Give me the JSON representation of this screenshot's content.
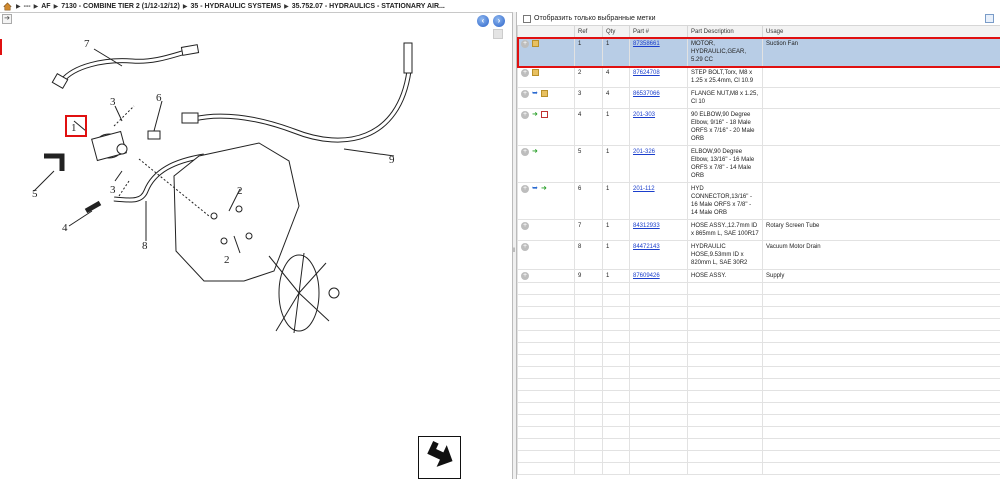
{
  "breadcrumb": {
    "items": [
      "---",
      "AF",
      "7130 - COMBINE TIER 2 (1/12-12/12)",
      "35 - HYDRAULIC SYSTEMS",
      "35.752.07 - HYDRAULICS - STATIONARY AIR..."
    ]
  },
  "diagram": {
    "callouts": [
      "1",
      "2",
      "2",
      "3",
      "3",
      "4",
      "5",
      "6",
      "7",
      "8",
      "9"
    ]
  },
  "filter": {
    "label": "Отобразить только выбранные метки",
    "checked": false
  },
  "table": {
    "headers": [
      "",
      "Ref",
      "Qty",
      "Part #",
      "Part Description",
      "Usage"
    ],
    "rows": [
      {
        "ref": "1",
        "qty": "1",
        "part": "87358661",
        "desc": "MOTOR, HYDRAULIC,GEAR, 5.29 CC",
        "usage": "Suction Fan",
        "icons": [
          "box"
        ],
        "selected": true
      },
      {
        "ref": "2",
        "qty": "4",
        "part": "87624708",
        "desc": "STEP BOLT,Torx, M8 x 1.25 x 25.4mm, Cl 10.9",
        "usage": "",
        "icons": [
          "box"
        ],
        "selected": false
      },
      {
        "ref": "3",
        "qty": "4",
        "part": "86537066",
        "desc": "FLANGE NUT,M8 x 1.25, Cl 10",
        "usage": "",
        "icons": [
          "blue",
          "box"
        ],
        "selected": false
      },
      {
        "ref": "4",
        "qty": "1",
        "part": "201-303",
        "desc": "90 ELBOW,90 Degree Elbow, 9/16\" - 18 Male ORFS x 7/16\" - 20 Male ORB",
        "usage": "",
        "icons": [
          "green",
          "doc"
        ],
        "selected": false
      },
      {
        "ref": "5",
        "qty": "1",
        "part": "201-326",
        "desc": "ELBOW,90 Degree Elbow, 13/16\" - 16 Male ORFS x 7/8\" - 14 Male ORB",
        "usage": "",
        "icons": [
          "green"
        ],
        "selected": false
      },
      {
        "ref": "6",
        "qty": "1",
        "part": "201-112",
        "desc": "HYD CONNECTOR,13/16\" - 16 Male ORFS x 7/8\" - 14 Male ORB",
        "usage": "",
        "icons": [
          "blue",
          "green"
        ],
        "selected": false
      },
      {
        "ref": "7",
        "qty": "1",
        "part": "84312933",
        "desc": "HOSE ASSY.,12.7mm ID x 865mm L, SAE 100R17",
        "usage": "Rotary Screen Tube",
        "icons": [],
        "selected": false
      },
      {
        "ref": "8",
        "qty": "1",
        "part": "84472143",
        "desc": "HYDRAULIC HOSE,9.53mm ID x 820mm L, SAE 30R2",
        "usage": "Vacuum Motor Drain",
        "icons": [],
        "selected": false
      },
      {
        "ref": "9",
        "qty": "1",
        "part": "87609426",
        "desc": "HOSE ASSY.",
        "usage": "Supply",
        "icons": [],
        "selected": false
      }
    ]
  }
}
